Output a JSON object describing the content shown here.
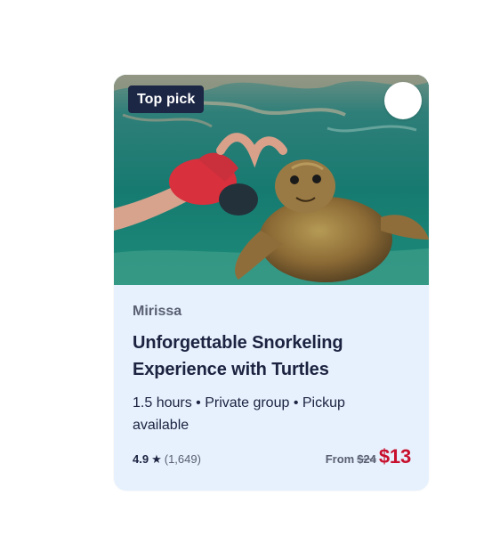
{
  "card": {
    "badge": "Top pick",
    "favorite_icon": "heart-outline-icon",
    "location": "Mirissa",
    "title": "Unforgettable Snorkeling Experience with Turtles",
    "details": "1.5 hours • Private group • Pickup available",
    "rating": {
      "score": "4.9",
      "star_icon": "star-icon",
      "count": "(1,649)"
    },
    "price": {
      "from_label": "From",
      "original": "$24",
      "current": "$13"
    }
  },
  "colors": {
    "badge_bg": "#1c2745",
    "card_bg": "#e6f1fd",
    "price_red": "#c8102e",
    "title_navy": "#1b2340",
    "muted": "#5a6072"
  }
}
